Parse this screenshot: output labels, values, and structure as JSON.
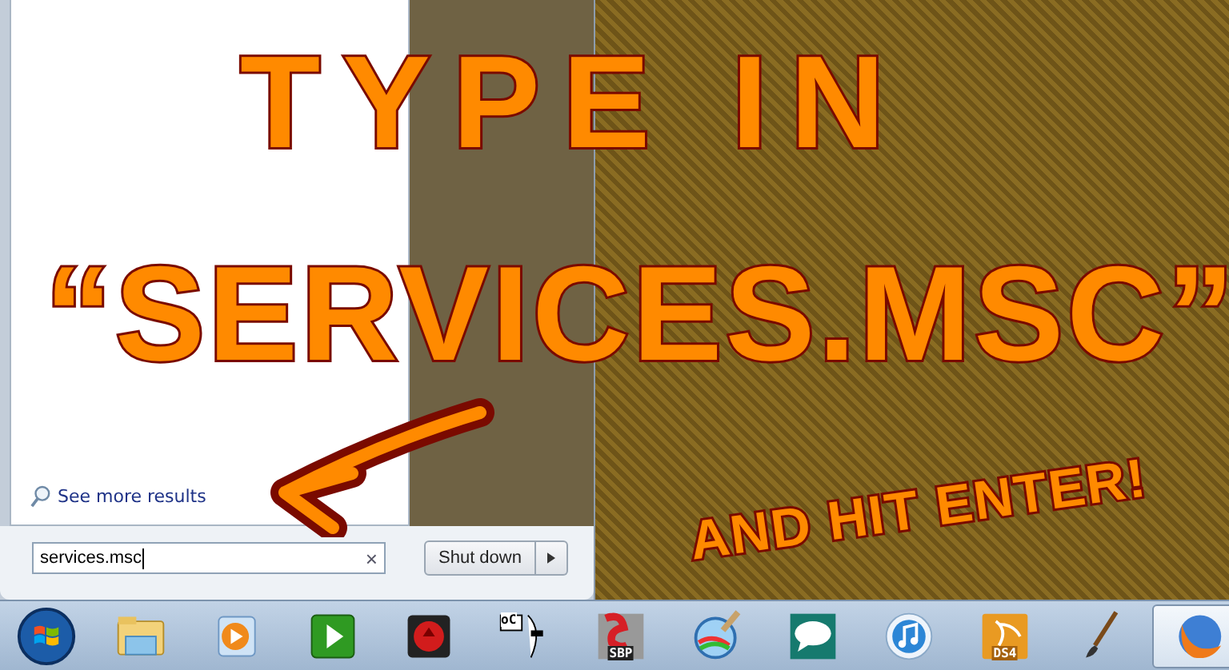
{
  "start_menu": {
    "see_more": "See more results",
    "search": {
      "value": "services.msc",
      "clear": "×"
    },
    "shutdown": {
      "label": "Shut down"
    }
  },
  "annotation": {
    "line_1": "TYPE IN",
    "line_2": "“SERVICES.MSC”",
    "line_3": "AND HIT ENTER!"
  },
  "taskbar": {
    "items": [
      {
        "kind": "folder",
        "selected": false
      },
      {
        "kind": "media",
        "selected": false
      },
      {
        "kind": "play",
        "selected": false
      },
      {
        "kind": "record",
        "selected": false
      },
      {
        "kind": "face",
        "badge": "oC",
        "selected": false
      },
      {
        "kind": "sbp",
        "badge": "SBP",
        "selected": false
      },
      {
        "kind": "paint",
        "selected": false
      },
      {
        "kind": "chat",
        "selected": false
      },
      {
        "kind": "music",
        "selected": false
      },
      {
        "kind": "ds4",
        "badge": "DS4",
        "selected": false
      },
      {
        "kind": "brush",
        "selected": false
      },
      {
        "kind": "browser",
        "selected": true
      }
    ]
  }
}
